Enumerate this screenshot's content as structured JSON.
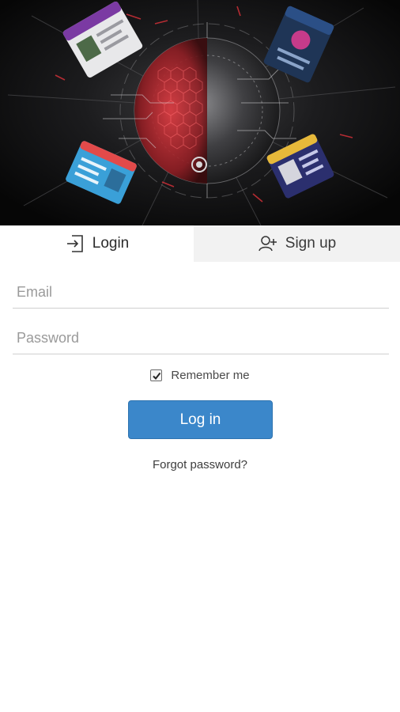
{
  "hero": {
    "image_description_icon": "hero-collage-image",
    "accent_color": "#c8242f",
    "card_colors": [
      "#7b3aa3",
      "#2e5e8e",
      "#3aa0d8",
      "#e7b93a"
    ]
  },
  "tabs": {
    "login": {
      "label": "Login",
      "icon": "login-icon",
      "active": true
    },
    "signup": {
      "label": "Sign up",
      "icon": "add-user-icon",
      "active": false
    }
  },
  "form": {
    "email": {
      "placeholder": "Email",
      "value": ""
    },
    "password": {
      "placeholder": "Password",
      "value": ""
    },
    "remember_me": {
      "label": "Remember me",
      "checked": true
    },
    "login_button": {
      "label": "Log in",
      "color": "#3b87ca"
    },
    "forgot_link": {
      "label": "Forgot password?"
    }
  }
}
